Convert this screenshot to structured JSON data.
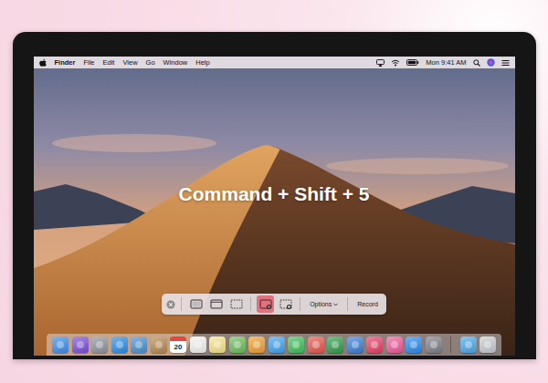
{
  "menu_bar": {
    "app": "Finder",
    "menus": [
      "File",
      "Edit",
      "View",
      "Go",
      "Window",
      "Help"
    ],
    "clock": "Mon 9:41 AM"
  },
  "overlay": {
    "text": "Command + Shift + 5"
  },
  "toolbar": {
    "modes": [
      {
        "kind": "capture-screen",
        "selected": false
      },
      {
        "kind": "capture-window",
        "selected": false
      },
      {
        "kind": "capture-selection",
        "selected": false
      },
      {
        "kind": "record-screen",
        "selected": true
      },
      {
        "kind": "record-selection",
        "selected": false
      }
    ],
    "options": "Options",
    "record": "Record"
  },
  "dock": {
    "apps": [
      {
        "kind": "app",
        "color": "#3d8ee8"
      },
      {
        "kind": "app",
        "color": "#7a4fd8"
      },
      {
        "kind": "app",
        "color": "#8f949c"
      },
      {
        "kind": "app",
        "color": "#2b8de6"
      },
      {
        "kind": "app",
        "color": "#4a90d0"
      },
      {
        "kind": "app",
        "color": "#b48a52"
      },
      {
        "kind": "calendar",
        "color": "#ffffff",
        "label": "20"
      },
      {
        "kind": "app",
        "color": "#f4f4f4"
      },
      {
        "kind": "app",
        "color": "#f7e58a"
      },
      {
        "kind": "app",
        "color": "#6cbf5c"
      },
      {
        "kind": "app",
        "color": "#f0a030"
      },
      {
        "kind": "app",
        "color": "#3fa3f0"
      },
      {
        "kind": "app",
        "color": "#3fc15a"
      },
      {
        "kind": "app",
        "color": "#e8574a"
      },
      {
        "kind": "app",
        "color": "#2f9e4a"
      },
      {
        "kind": "app",
        "color": "#3a7fd8"
      },
      {
        "kind": "app",
        "color": "#e83f6a"
      },
      {
        "kind": "app",
        "color": "#f05a9a"
      },
      {
        "kind": "app",
        "color": "#2a8af0"
      },
      {
        "kind": "app",
        "color": "#7d8088"
      }
    ],
    "stacks": [
      {
        "kind": "app",
        "color": "#4aa8e8"
      },
      {
        "kind": "app",
        "color": "#c8ccd2"
      }
    ]
  }
}
